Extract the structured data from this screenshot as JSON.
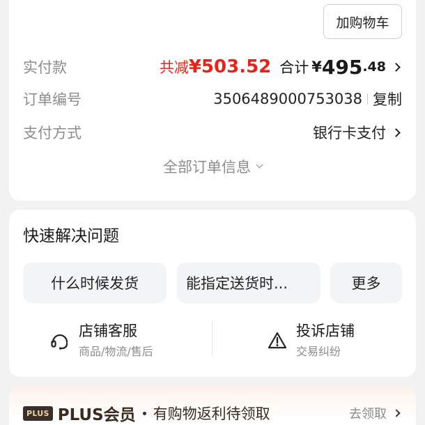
{
  "order": {
    "add_cart_label": "加购物车",
    "paid_label": "实付款",
    "reduce_text": "共减",
    "reduce_amount": "¥503.52",
    "total_label": "合计",
    "total_currency": "¥",
    "total_integer": "495",
    "total_decimal": ".48",
    "order_no_label": "订单编号",
    "order_no": "3506489000753038",
    "copy_label": "复制",
    "pay_method_label": "支付方式",
    "pay_method_value": "银行卡支付",
    "all_info_label": "全部订单信息"
  },
  "quick": {
    "title": "快速解决问题",
    "chips": [
      "什么时候发货",
      "能指定送货时...",
      "更多"
    ],
    "services": [
      {
        "name": "店铺客服",
        "sub": "商品/物流/售后",
        "icon": "headset-icon"
      },
      {
        "name": "投诉店铺",
        "sub": "交易纠纷",
        "icon": "warning-icon"
      }
    ]
  },
  "plus": {
    "badge": "PLUS",
    "title": "PLUS会员",
    "desc": "有购物返利待领取",
    "link": "去领取"
  },
  "colors": {
    "accent_red": "#e1251b",
    "muted": "#8c8c8c",
    "plus_badge_bg": "#3b2f2c"
  }
}
